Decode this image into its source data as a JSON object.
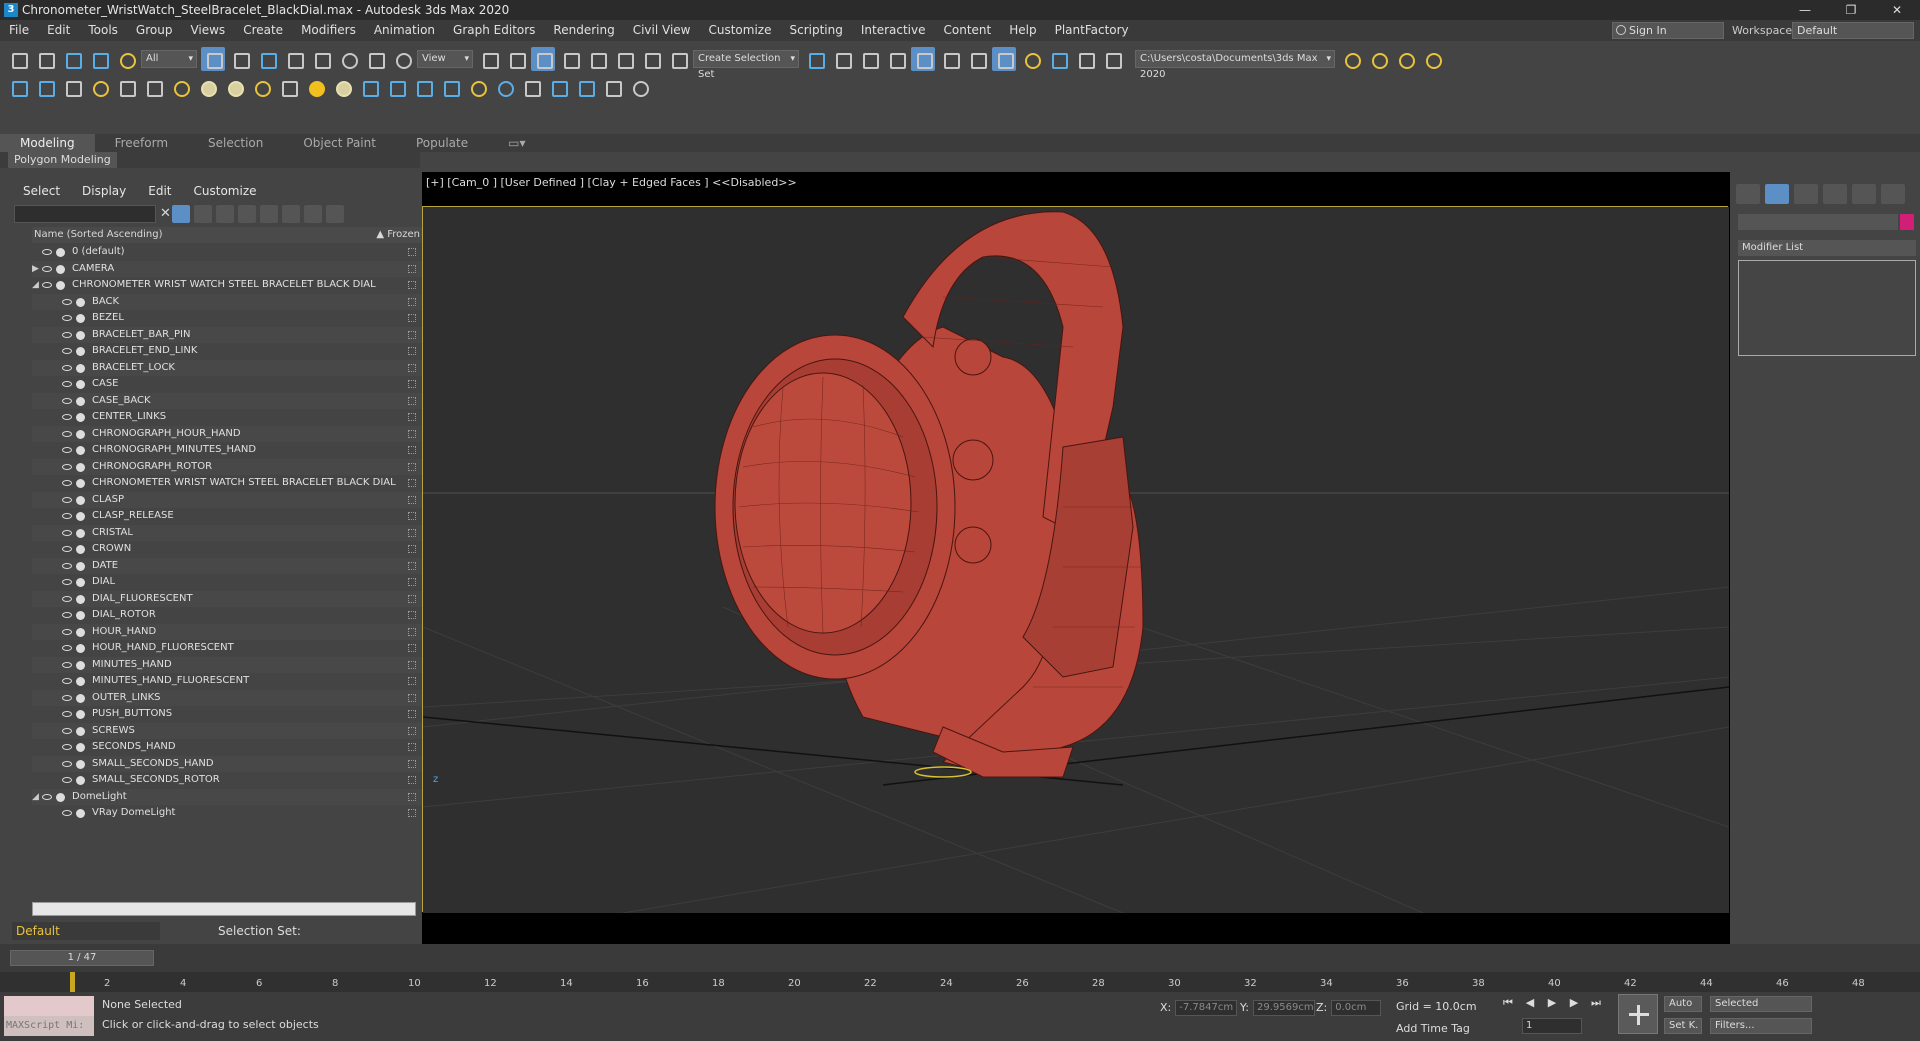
{
  "window": {
    "title": "Chronometer_WristWatch_SteelBracelet_BlackDial.max - Autodesk 3ds Max 2020",
    "app_icon": "3",
    "controls": [
      "—",
      "❐",
      "✕"
    ]
  },
  "menu": [
    "File",
    "Edit",
    "Tools",
    "Group",
    "Views",
    "Create",
    "Modifiers",
    "Animation",
    "Graph Editors",
    "Rendering",
    "Civil View",
    "Customize",
    "Scripting",
    "Interactive",
    "Content",
    "Help",
    "PlantFactory"
  ],
  "account": {
    "sign_in": "Sign In",
    "workspaces_label": "Workspaces:",
    "workspace": "Default"
  },
  "toolbar": {
    "filter": "All",
    "view": "View",
    "selection_set": "Create Selection Set",
    "path": "C:\\Users\\costa\\Documents\\3ds Max 2020"
  },
  "ribbon": {
    "tabs": [
      "Modeling",
      "Freeform",
      "Selection",
      "Object Paint",
      "Populate"
    ],
    "active": "Modeling",
    "sub": "Polygon Modeling"
  },
  "scene_explorer": {
    "menu": [
      "Select",
      "Display",
      "Edit",
      "Customize"
    ],
    "header": "Name (Sorted Ascending)",
    "frozen": "▲ Frozen",
    "rows": [
      {
        "label": "0 (default)",
        "level": 0,
        "expand": ""
      },
      {
        "label": "CAMERA",
        "level": 0,
        "expand": "▶"
      },
      {
        "label": "CHRONOMETER WRIST WATCH STEEL BRACELET BLACK DIAL",
        "level": 0,
        "expand": "◢"
      },
      {
        "label": "BACK",
        "level": 1
      },
      {
        "label": "BEZEL",
        "level": 1
      },
      {
        "label": "BRACELET_BAR_PIN",
        "level": 1
      },
      {
        "label": "BRACELET_END_LINK",
        "level": 1
      },
      {
        "label": "BRACELET_LOCK",
        "level": 1
      },
      {
        "label": "CASE",
        "level": 1
      },
      {
        "label": "CASE_BACK",
        "level": 1
      },
      {
        "label": "CENTER_LINKS",
        "level": 1
      },
      {
        "label": "CHRONOGRAPH_HOUR_HAND",
        "level": 1
      },
      {
        "label": "CHRONOGRAPH_MINUTES_HAND",
        "level": 1
      },
      {
        "label": "CHRONOGRAPH_ROTOR",
        "level": 1
      },
      {
        "label": "CHRONOMETER WRIST WATCH STEEL BRACELET BLACK DIAL",
        "level": 1
      },
      {
        "label": "CLASP",
        "level": 1
      },
      {
        "label": "CLASP_RELEASE",
        "level": 1
      },
      {
        "label": "CRISTAL",
        "level": 1
      },
      {
        "label": "CROWN",
        "level": 1
      },
      {
        "label": "DATE",
        "level": 1
      },
      {
        "label": "DIAL",
        "level": 1
      },
      {
        "label": "DIAL_FLUORESCENT",
        "level": 1
      },
      {
        "label": "DIAL_ROTOR",
        "level": 1
      },
      {
        "label": "HOUR_HAND",
        "level": 1
      },
      {
        "label": "HOUR_HAND_FLUORESCENT",
        "level": 1
      },
      {
        "label": "MINUTES_HAND",
        "level": 1
      },
      {
        "label": "MINUTES_HAND_FLUORESCENT",
        "level": 1
      },
      {
        "label": "OUTER_LINKS",
        "level": 1
      },
      {
        "label": "PUSH_BUTTONS",
        "level": 1
      },
      {
        "label": "SCREWS",
        "level": 1
      },
      {
        "label": "SECONDS_HAND",
        "level": 1
      },
      {
        "label": "SMALL_SECONDS_HAND",
        "level": 1
      },
      {
        "label": "SMALL_SECONDS_ROTOR",
        "level": 1
      },
      {
        "label": "DomeLight",
        "level": 0,
        "expand": "◢"
      },
      {
        "label": "VRay DomeLight",
        "level": 1
      }
    ],
    "layer": "Default",
    "selection_set_label": "Selection Set:"
  },
  "viewport": {
    "label": "[+] [Cam_0 ] [User Defined ] [Clay + Edged Faces ]  <<Disabled>>",
    "model_color": "#b9463a"
  },
  "command_panel": {
    "modifier_list": "Modifier List",
    "color_swatch": "#d11f78"
  },
  "time": {
    "slider": "1 / 47",
    "ticks": [
      2,
      4,
      6,
      8,
      10,
      12,
      14,
      16,
      18,
      20,
      22,
      24,
      26,
      28,
      30,
      32,
      34,
      36,
      38,
      40,
      42,
      44,
      46,
      48
    ]
  },
  "status": {
    "maxscript": "MAXScript Mi:",
    "selected": "None Selected",
    "hint": "Click or click-and-drag to select objects",
    "x_label": "X:",
    "x": "-7.7847cm",
    "y_label": "Y:",
    "y": "29.9569cm",
    "z_label": "Z:",
    "z": "0.0cm",
    "grid": "Grid = 10.0cm",
    "add_time_tag": "Add Time Tag",
    "auto": "Auto",
    "selected_mode": "Selected",
    "set_key": "Set K.",
    "filters": "Filters...",
    "frame": "1"
  }
}
